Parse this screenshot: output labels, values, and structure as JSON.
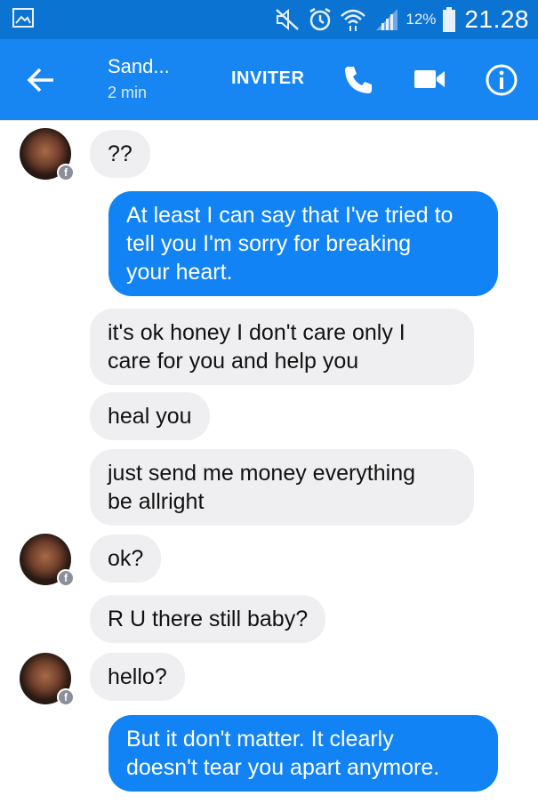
{
  "status_bar": {
    "gallery_icon": "image-icon",
    "mute_icon": "mute-icon",
    "alarm_icon": "alarm-icon",
    "wifi_icon": "wifi-icon",
    "signal_icon": "signal-icon",
    "battery_icon": "battery-icon",
    "battery_percent": "12%",
    "time": "21.28"
  },
  "header": {
    "back_icon": "arrow-left-icon",
    "contact_name": "Sand...",
    "last_active": "2 min",
    "invite_label": "INVITER",
    "call_icon": "phone-icon",
    "video_icon": "video-camera-icon",
    "info_icon": "info-icon",
    "bar_color": "#1886f2",
    "status_color": "#0b73d1"
  },
  "messages": [
    {
      "sender": "them",
      "text_lines": [
        "??"
      ]
    },
    {
      "sender": "me",
      "text_lines": [
        "At least I can say that I've tried to",
        "tell you I'm sorry for breaking",
        "your heart."
      ]
    },
    {
      "sender": "them",
      "text_lines": [
        "it's ok honey I don't care only I",
        "care for you and help you"
      ]
    },
    {
      "sender": "them",
      "text_lines": [
        "heal you"
      ]
    },
    {
      "sender": "them",
      "text_lines": [
        "just send me money everything",
        "be allright"
      ]
    },
    {
      "sender": "them",
      "text_lines": [
        "ok?"
      ]
    },
    {
      "sender": "them",
      "text_lines": [
        "R U there still baby?"
      ]
    },
    {
      "sender": "them",
      "text_lines": [
        "hello?"
      ]
    },
    {
      "sender": "me",
      "text_lines": [
        "But it don't matter. It clearly",
        "doesn't tear you apart anymore."
      ]
    }
  ],
  "colors": {
    "incoming_bubble": "#efeff1",
    "outgoing_bubble": "#1183f5"
  }
}
